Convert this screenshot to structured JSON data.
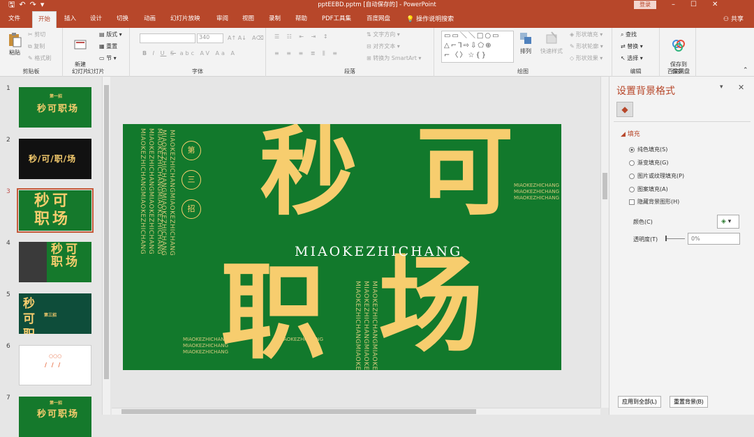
{
  "titlebar": {
    "save_icon": "save-icon",
    "undo_icon": "undo-icon",
    "redo_icon": "redo-icon",
    "title": "pptEEBD.pptm [自动保存的] - PowerPoint",
    "login": "登录",
    "minimize": "–",
    "maximize": "☐",
    "close": "✕"
  },
  "tabs": [
    "文件",
    "开始",
    "插入",
    "设计",
    "切换",
    "动画",
    "幻灯片放映",
    "审阅",
    "视图",
    "录制",
    "帮助",
    "PDF工具集",
    "百度网盘"
  ],
  "active_tab": "开始",
  "tell_me": "操作说明搜索",
  "share": "共享",
  "ribbon": {
    "clipboard": {
      "paste": "粘贴",
      "cut": "剪切",
      "copy": "复制",
      "format_painter": "格式刷",
      "label": "剪贴板"
    },
    "slides": {
      "new_slide": "新建\n幻灯片",
      "layout": "版式",
      "reset": "重置",
      "section": "节",
      "label": "幻灯片"
    },
    "font": {
      "size": "340",
      "label": "字体",
      "bold": "B",
      "italic": "I",
      "underline": "U",
      "strike": "S",
      "shadow": "abc",
      "spacing": "AV",
      "case": "Aa",
      "color": "A"
    },
    "paragraph": {
      "text_direction": "文字方向",
      "align_text": "对齐文本",
      "smartart": "转换为 SmartArt",
      "label": "段落"
    },
    "drawing": {
      "arrange": "排列",
      "quick_styles": "快速样式",
      "shape_fill": "形状填充",
      "shape_outline": "形状轮廓",
      "shape_effects": "形状效果",
      "label": "绘图"
    },
    "editing": {
      "find": "查找",
      "replace": "替换",
      "select": "选择",
      "label": "编辑"
    },
    "save": {
      "save_to": "保存到\n百度网盘",
      "label": "保存"
    }
  },
  "thumbnails": [
    {
      "num": "1",
      "text": "秒可职场",
      "tag": "第一招"
    },
    {
      "num": "2",
      "text": "秒/可/职/场"
    },
    {
      "num": "3",
      "text": "秒可职场",
      "selected": true
    },
    {
      "num": "4",
      "text": "秒可职场"
    },
    {
      "num": "5",
      "text": "秒可职场",
      "tag": "第三招"
    },
    {
      "num": "6",
      "text": "/ / /",
      "tag": "○○○"
    },
    {
      "num": "7",
      "text": "秒可职场",
      "tag": "第一招"
    }
  ],
  "slide": {
    "big_chars": [
      "秒",
      "可",
      "职",
      "场"
    ],
    "subtitle": "MIAOKEZHICHANG",
    "circles": [
      "第",
      "三",
      "招"
    ],
    "vertical_text": "MIAOKEZHICHANGMIAOKEZHICHANG",
    "small_text": "MIAOKEZHICHANG",
    "bg": "#12792c",
    "accent": "#f7cd6e"
  },
  "pane": {
    "title": "设置背景格式",
    "section": "填充",
    "options": [
      "纯色填充(S)",
      "渐变填充(G)",
      "图片或纹理填充(P)",
      "图案填充(A)"
    ],
    "hide_bg": "隐藏背景图形(H)",
    "color_label": "颜色(C)",
    "transparency_label": "透明度(T)",
    "transparency_value": "0%",
    "apply_all": "应用到全部(L)",
    "reset_bg": "重置背景(B)"
  }
}
